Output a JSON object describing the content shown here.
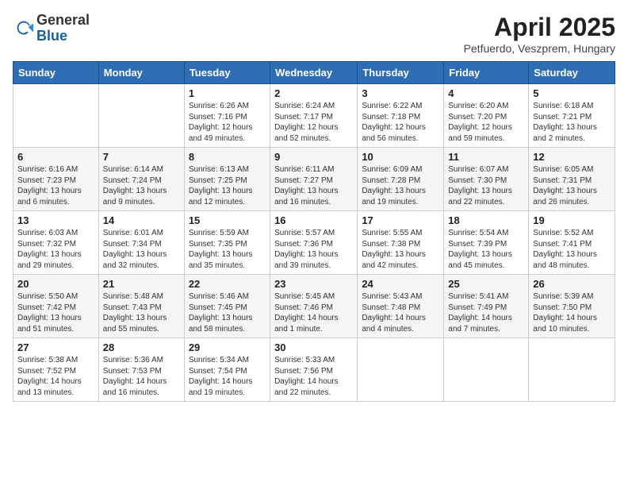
{
  "logo": {
    "general": "General",
    "blue": "Blue"
  },
  "header": {
    "month": "April 2025",
    "location": "Petfuerdo, Veszprem, Hungary"
  },
  "weekdays": [
    "Sunday",
    "Monday",
    "Tuesday",
    "Wednesday",
    "Thursday",
    "Friday",
    "Saturday"
  ],
  "weeks": [
    [
      {
        "day": "",
        "info": ""
      },
      {
        "day": "",
        "info": ""
      },
      {
        "day": "1",
        "info": "Sunrise: 6:26 AM\nSunset: 7:16 PM\nDaylight: 12 hours and 49 minutes."
      },
      {
        "day": "2",
        "info": "Sunrise: 6:24 AM\nSunset: 7:17 PM\nDaylight: 12 hours and 52 minutes."
      },
      {
        "day": "3",
        "info": "Sunrise: 6:22 AM\nSunset: 7:18 PM\nDaylight: 12 hours and 56 minutes."
      },
      {
        "day": "4",
        "info": "Sunrise: 6:20 AM\nSunset: 7:20 PM\nDaylight: 12 hours and 59 minutes."
      },
      {
        "day": "5",
        "info": "Sunrise: 6:18 AM\nSunset: 7:21 PM\nDaylight: 13 hours and 2 minutes."
      }
    ],
    [
      {
        "day": "6",
        "info": "Sunrise: 6:16 AM\nSunset: 7:23 PM\nDaylight: 13 hours and 6 minutes."
      },
      {
        "day": "7",
        "info": "Sunrise: 6:14 AM\nSunset: 7:24 PM\nDaylight: 13 hours and 9 minutes."
      },
      {
        "day": "8",
        "info": "Sunrise: 6:13 AM\nSunset: 7:25 PM\nDaylight: 13 hours and 12 minutes."
      },
      {
        "day": "9",
        "info": "Sunrise: 6:11 AM\nSunset: 7:27 PM\nDaylight: 13 hours and 16 minutes."
      },
      {
        "day": "10",
        "info": "Sunrise: 6:09 AM\nSunset: 7:28 PM\nDaylight: 13 hours and 19 minutes."
      },
      {
        "day": "11",
        "info": "Sunrise: 6:07 AM\nSunset: 7:30 PM\nDaylight: 13 hours and 22 minutes."
      },
      {
        "day": "12",
        "info": "Sunrise: 6:05 AM\nSunset: 7:31 PM\nDaylight: 13 hours and 26 minutes."
      }
    ],
    [
      {
        "day": "13",
        "info": "Sunrise: 6:03 AM\nSunset: 7:32 PM\nDaylight: 13 hours and 29 minutes."
      },
      {
        "day": "14",
        "info": "Sunrise: 6:01 AM\nSunset: 7:34 PM\nDaylight: 13 hours and 32 minutes."
      },
      {
        "day": "15",
        "info": "Sunrise: 5:59 AM\nSunset: 7:35 PM\nDaylight: 13 hours and 35 minutes."
      },
      {
        "day": "16",
        "info": "Sunrise: 5:57 AM\nSunset: 7:36 PM\nDaylight: 13 hours and 39 minutes."
      },
      {
        "day": "17",
        "info": "Sunrise: 5:55 AM\nSunset: 7:38 PM\nDaylight: 13 hours and 42 minutes."
      },
      {
        "day": "18",
        "info": "Sunrise: 5:54 AM\nSunset: 7:39 PM\nDaylight: 13 hours and 45 minutes."
      },
      {
        "day": "19",
        "info": "Sunrise: 5:52 AM\nSunset: 7:41 PM\nDaylight: 13 hours and 48 minutes."
      }
    ],
    [
      {
        "day": "20",
        "info": "Sunrise: 5:50 AM\nSunset: 7:42 PM\nDaylight: 13 hours and 51 minutes."
      },
      {
        "day": "21",
        "info": "Sunrise: 5:48 AM\nSunset: 7:43 PM\nDaylight: 13 hours and 55 minutes."
      },
      {
        "day": "22",
        "info": "Sunrise: 5:46 AM\nSunset: 7:45 PM\nDaylight: 13 hours and 58 minutes."
      },
      {
        "day": "23",
        "info": "Sunrise: 5:45 AM\nSunset: 7:46 PM\nDaylight: 14 hours and 1 minute."
      },
      {
        "day": "24",
        "info": "Sunrise: 5:43 AM\nSunset: 7:48 PM\nDaylight: 14 hours and 4 minutes."
      },
      {
        "day": "25",
        "info": "Sunrise: 5:41 AM\nSunset: 7:49 PM\nDaylight: 14 hours and 7 minutes."
      },
      {
        "day": "26",
        "info": "Sunrise: 5:39 AM\nSunset: 7:50 PM\nDaylight: 14 hours and 10 minutes."
      }
    ],
    [
      {
        "day": "27",
        "info": "Sunrise: 5:38 AM\nSunset: 7:52 PM\nDaylight: 14 hours and 13 minutes."
      },
      {
        "day": "28",
        "info": "Sunrise: 5:36 AM\nSunset: 7:53 PM\nDaylight: 14 hours and 16 minutes."
      },
      {
        "day": "29",
        "info": "Sunrise: 5:34 AM\nSunset: 7:54 PM\nDaylight: 14 hours and 19 minutes."
      },
      {
        "day": "30",
        "info": "Sunrise: 5:33 AM\nSunset: 7:56 PM\nDaylight: 14 hours and 22 minutes."
      },
      {
        "day": "",
        "info": ""
      },
      {
        "day": "",
        "info": ""
      },
      {
        "day": "",
        "info": ""
      }
    ]
  ]
}
